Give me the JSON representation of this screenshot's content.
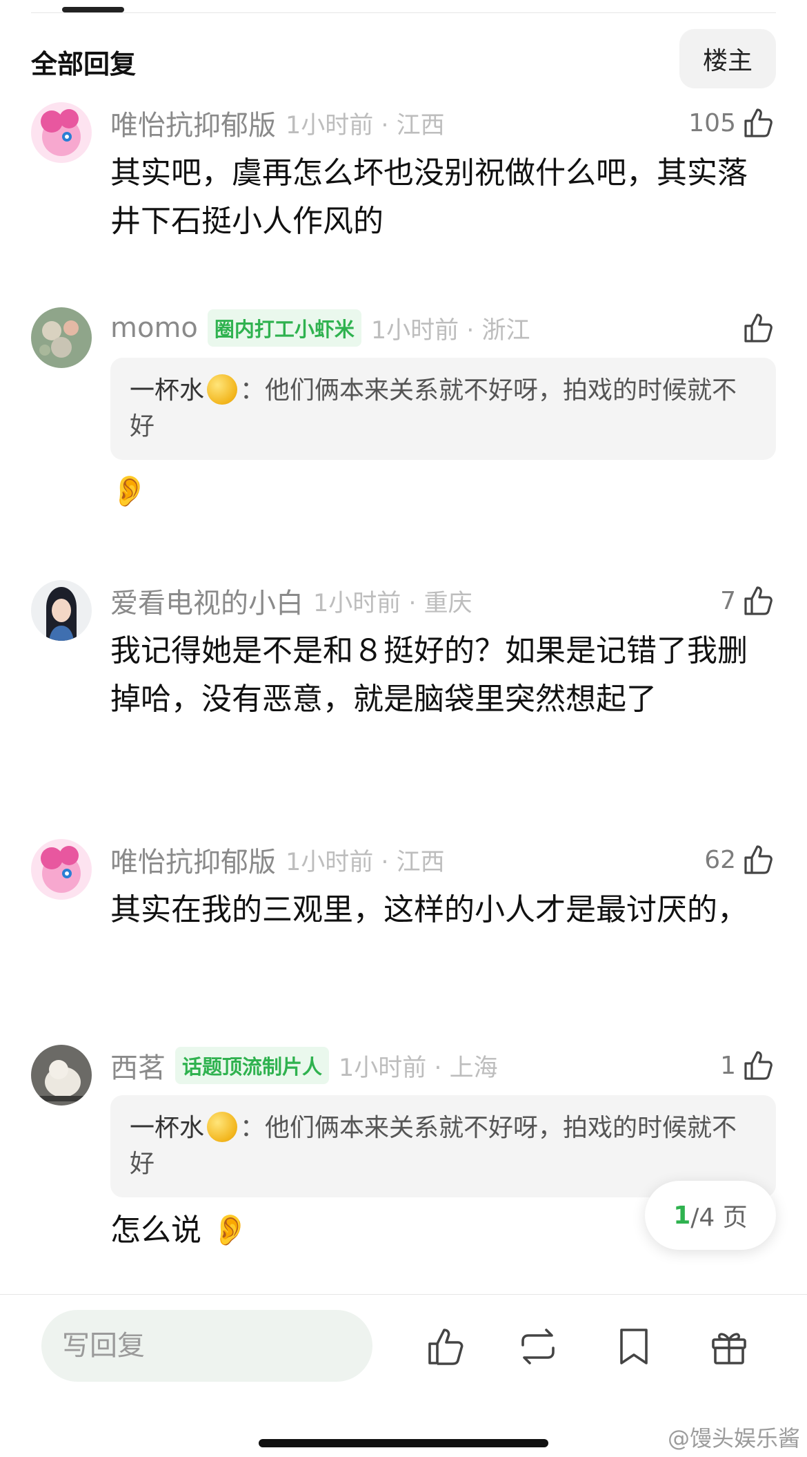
{
  "header": {
    "section_title": "全部回复",
    "owner_button": "楼主"
  },
  "comments": [
    {
      "name": "唯怡抗抑郁版",
      "badge": "",
      "time_location": "1小时前 · 江西",
      "likes": "105",
      "text": "其实吧，虞再怎么坏也没别祝做什么吧，其实落井下石挺小人作风的",
      "quote": null
    },
    {
      "name": "momo",
      "badge": "圈内打工小虾米",
      "time_location": "1小时前 · 浙江",
      "likes": "",
      "text": "👂",
      "quote": {
        "name": "一杯水",
        "sep": "：",
        "text": "他们俩本来关系就不好呀，拍戏的时候就不好"
      }
    },
    {
      "name": "爱看电视的小白",
      "badge": "",
      "time_location": "1小时前 · 重庆",
      "likes": "7",
      "text": "我记得她是不是和８挺好的？如果是记错了我删掉哈，没有恶意，就是脑袋里突然想起了",
      "quote": null
    },
    {
      "name": "唯怡抗抑郁版",
      "badge": "",
      "time_location": "1小时前 · 江西",
      "likes": "62",
      "text": "其实在我的三观里，这样的小人才是最讨厌的，",
      "quote": null
    },
    {
      "name": "西茗",
      "badge": "话题顶流制片人",
      "time_location": "1小时前 · 上海",
      "likes": "1",
      "text": "怎么说 👂",
      "quote": {
        "name": "一杯水",
        "sep": "：",
        "text": "他们俩本来关系就不好呀，拍戏的时候就不好"
      }
    }
  ],
  "pager": {
    "current": "1",
    "total_text": "/4 页"
  },
  "bottom_bar": {
    "reply_placeholder": "写回复",
    "actions": [
      "thumbs-up-icon",
      "repost-icon",
      "bookmark-icon",
      "gift-icon"
    ]
  },
  "watermark": "@馒头娱乐酱",
  "colors": {
    "accent": "#2fb24f",
    "badge_bg": "#eaf8ed",
    "muted": "#8a8a8a"
  }
}
